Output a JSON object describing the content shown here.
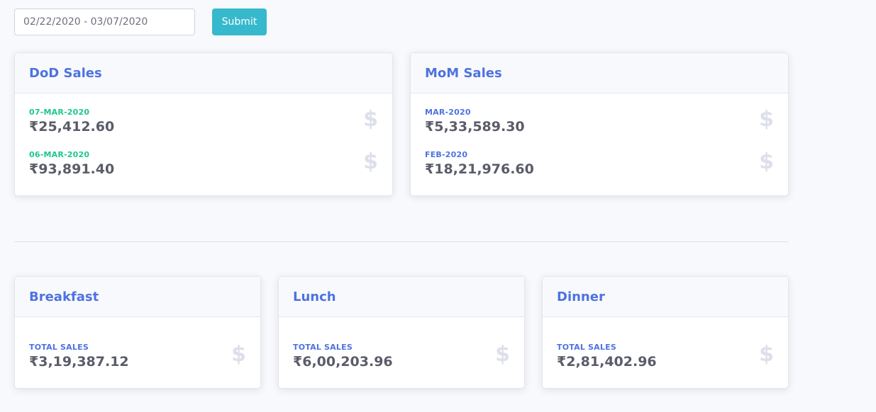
{
  "filter": {
    "date_range": "02/22/2020 - 03/07/2020",
    "submit_label": "Submit"
  },
  "dod": {
    "title": "DoD Sales",
    "items": [
      {
        "label": "07-MAR-2020",
        "value": "₹25,412.60"
      },
      {
        "label": "06-MAR-2020",
        "value": "₹93,891.40"
      }
    ]
  },
  "mom": {
    "title": "MoM Sales",
    "items": [
      {
        "label": "MAR-2020",
        "value": "₹5,33,589.30"
      },
      {
        "label": "FEB-2020",
        "value": "₹18,21,976.60"
      }
    ]
  },
  "meals": [
    {
      "title": "Breakfast",
      "label": "TOTAL SALES",
      "value": "₹3,19,387.12"
    },
    {
      "title": "Lunch",
      "label": "TOTAL SALES",
      "value": "₹6,00,203.96"
    },
    {
      "title": "Dinner",
      "label": "TOTAL SALES",
      "value": "₹2,81,402.96"
    }
  ],
  "icons": {
    "dollar": "$"
  },
  "colors": {
    "primary": "#4e73df",
    "success": "#1cc88a",
    "info": "#36b9cc",
    "text": "#5a5c69",
    "icon": "#dddfeb"
  }
}
